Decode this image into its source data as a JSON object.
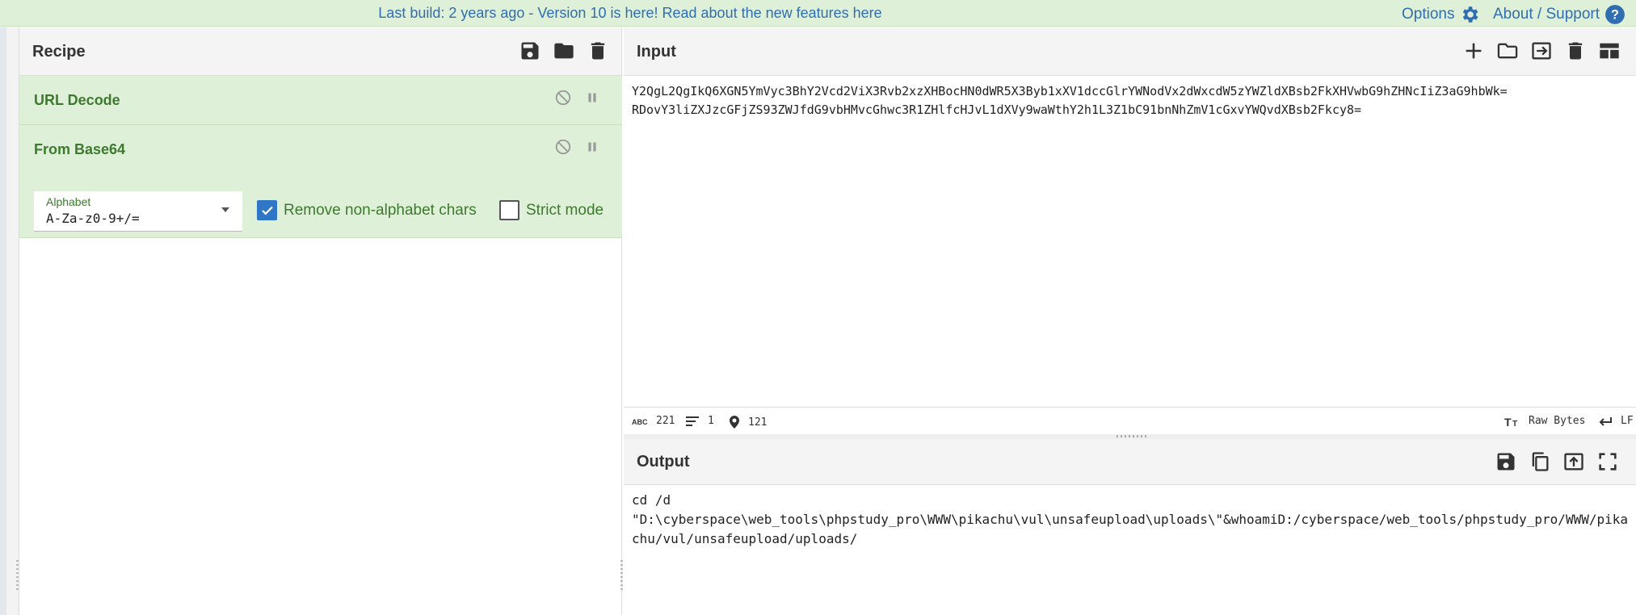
{
  "banner": {
    "text": "Last build: 2 years ago - Version 10 is here! Read about the new features here",
    "options_label": "Options",
    "support_label": "About / Support"
  },
  "recipe": {
    "title": "Recipe",
    "operations": [
      {
        "name": "URL Decode"
      },
      {
        "name": "From Base64",
        "alphabet_label": "Alphabet",
        "alphabet_value": "A-Za-z0-9+/=",
        "remove_non_alphabet_label": "Remove non-alphabet chars",
        "remove_non_alphabet_checked": true,
        "strict_mode_label": "Strict mode",
        "strict_mode_checked": false
      }
    ]
  },
  "input": {
    "title": "Input",
    "line1": "Y2QgL2QgIkQ6XGN5YmVyc3BhY2Vcd2ViX3Rvb2xzXHBocHN0dWR5X3Byb1xXV1dccGlrYWNodVx2dWxcdW5zYWZldXBsb2FkXHVwbG9hZHNcIiZ3aG9hbWk=",
    "line2": "RDovY3liZXJzcGFjZS93ZWJfdG9vbHMvcGhwc3R1ZHlfcHJvL1dXVy9waWthY2h1L3Z1bC91bnNhZmV1cGxvYWQvdXBsb2Fkcy8=",
    "status": {
      "length": "221",
      "lines": "1",
      "position": "121",
      "encoding": "Raw Bytes",
      "eol": "LF"
    }
  },
  "output": {
    "title": "Output",
    "line1": "cd /d",
    "line2": "\"D:\\cyberspace\\web_tools\\phpstudy_pro\\WWW\\pikachu\\vul\\unsafeupload\\uploads\\\"&whoamiD:/cyberspace/web_tools/phpstudy_pro/WWW/pika",
    "line3": "chu/vul/unsafeupload/uploads/"
  },
  "colors": {
    "banner_bg": "#dff0d8",
    "operation_bg": "#dff0d8",
    "operation_text": "#3d7a2e",
    "link": "#2f6eb0",
    "checkbox_on": "#2f77c6"
  },
  "icons": [
    "gear-icon",
    "help-icon",
    "save-icon",
    "folder-icon",
    "trash-icon",
    "disable-icon",
    "pause-icon",
    "plus-icon",
    "import-icon",
    "layout-icon",
    "copy-icon",
    "replace-input-icon",
    "maximize-icon",
    "abc-icon",
    "lines-icon",
    "pin-icon",
    "text-size-icon",
    "newline-icon"
  ]
}
